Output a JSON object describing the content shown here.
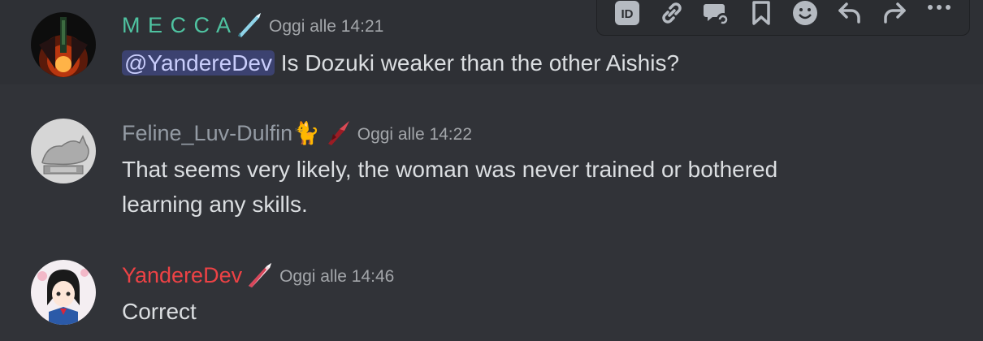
{
  "toolbar": {
    "icons": [
      "id-icon",
      "link-icon",
      "thread-icon",
      "bookmark-icon",
      "emoji-icon",
      "reply-icon",
      "forward-icon",
      "more-icon"
    ],
    "id_label": "ID"
  },
  "messages": [
    {
      "username": "M E C C A",
      "username_color": "#4fc3a1",
      "role_icon": "teal-sword-icon",
      "timestamp": "Oggi alle 14:21",
      "mention": "@YandereDev",
      "text": " Is Dozuki weaker than the other Aishis?"
    },
    {
      "username": "Feline_Luv-Dulfin🐈",
      "username_color": "#949ba4",
      "role_icon": "red-blade-icon",
      "timestamp": "Oggi alle 14:22",
      "text_lines": [
        "That seems very likely, the woman was never trained or bothered",
        "learning any skills."
      ]
    },
    {
      "username": "YandereDev",
      "username_color": "#ed4245",
      "role_icon": "pink-sword-icon",
      "timestamp": "Oggi alle 14:46",
      "text": "Correct"
    }
  ]
}
